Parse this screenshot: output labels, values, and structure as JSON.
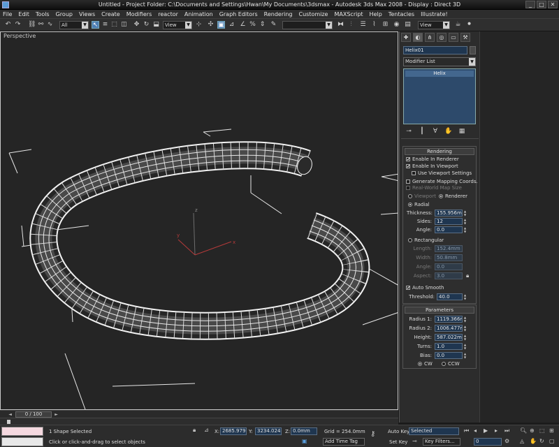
{
  "window": {
    "title": "Untitled    - Project Folder: C:\\Documents and Settings\\Hwan\\My Documents\\3dsmax    - Autodesk 3ds Max 2008    - Display : Direct 3D",
    "controls": [
      "_",
      "□",
      "✕"
    ]
  },
  "menu": [
    "File",
    "Edit",
    "Tools",
    "Group",
    "Views",
    "Create",
    "Modifiers",
    "reactor",
    "Animation",
    "Graph Editors",
    "Rendering",
    "Customize",
    "MAXScript",
    "Help",
    "Tentacles",
    "Illustrate!"
  ],
  "toolbar": {
    "selection_filter": "All",
    "ref_coord": "View",
    "named_selection": "",
    "render_view": "View"
  },
  "viewport": {
    "label": "Perspective"
  },
  "command_panel": {
    "object_name": "Helix01",
    "modifier_list": "Modifier List",
    "stack_item": "Helix",
    "rendering": {
      "title": "Rendering",
      "enable_in_renderer": "Enable In Renderer",
      "enable_in_viewport": "Enable In Viewport",
      "use_viewport_settings": "Use Viewport Settings",
      "gen_mapping": "Generate Mapping Coords.",
      "real_world": "Real-World Map Size",
      "viewport_radio": "Viewport",
      "renderer_radio": "Renderer",
      "radial": "Radial",
      "thickness_label": "Thickness:",
      "thickness": "155.956mm",
      "sides_label": "Sides:",
      "sides": "12",
      "angle_label": "Angle:",
      "angle": "0.0",
      "rectangular": "Rectangular",
      "length_label": "Length:",
      "length": "152.4mm",
      "width_label": "Width:",
      "width": "50.8mm",
      "rect_angle_label": "Angle:",
      "rect_angle": "0.0",
      "aspect_label": "Aspect:",
      "aspect": "3.0",
      "auto_smooth": "Auto Smooth",
      "threshold_label": "Threshold:",
      "threshold": "40.0"
    },
    "parameters": {
      "title": "Parameters",
      "radius1_label": "Radius 1:",
      "radius1": "1119.366mm",
      "radius2_label": "Radius 2:",
      "radius2": "1006.477mm",
      "height_label": "Height:",
      "height": "587.022mm",
      "turns_label": "Turns:",
      "turns": "1.0",
      "bias_label": "Bias:",
      "bias": "0.0",
      "cw": "CW",
      "ccw": "CCW"
    }
  },
  "timeline": {
    "frame": "0 / 100"
  },
  "status": {
    "selection": "1 Shape Selected",
    "prompt": "Click or click-and-drag to select objects",
    "x_label": "X:",
    "x": "2685.979mm",
    "y_label": "Y:",
    "y": "3234.024mm",
    "z_label": "Z:",
    "z": "0.0mm",
    "grid": "Grid = 254.0mm",
    "add_time_tag": "Add Time Tag",
    "auto_key": "Auto Key",
    "set_key": "Set Key",
    "key_mode": "Selected",
    "key_filters": "Key Filters...",
    "frame_field": "0"
  }
}
